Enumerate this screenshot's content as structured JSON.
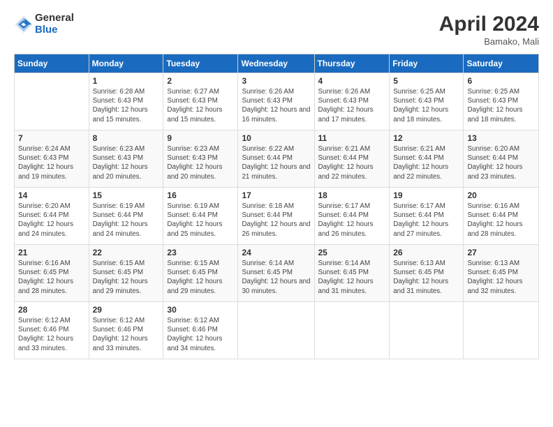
{
  "header": {
    "logo_line1": "General",
    "logo_line2": "Blue",
    "title": "April 2024",
    "subtitle": "Bamako, Mali"
  },
  "weekdays": [
    "Sunday",
    "Monday",
    "Tuesday",
    "Wednesday",
    "Thursday",
    "Friday",
    "Saturday"
  ],
  "weeks": [
    [
      {
        "day": "",
        "sunrise": "",
        "sunset": "",
        "daylight": ""
      },
      {
        "day": "1",
        "sunrise": "Sunrise: 6:28 AM",
        "sunset": "Sunset: 6:43 PM",
        "daylight": "Daylight: 12 hours and 15 minutes."
      },
      {
        "day": "2",
        "sunrise": "Sunrise: 6:27 AM",
        "sunset": "Sunset: 6:43 PM",
        "daylight": "Daylight: 12 hours and 15 minutes."
      },
      {
        "day": "3",
        "sunrise": "Sunrise: 6:26 AM",
        "sunset": "Sunset: 6:43 PM",
        "daylight": "Daylight: 12 hours and 16 minutes."
      },
      {
        "day": "4",
        "sunrise": "Sunrise: 6:26 AM",
        "sunset": "Sunset: 6:43 PM",
        "daylight": "Daylight: 12 hours and 17 minutes."
      },
      {
        "day": "5",
        "sunrise": "Sunrise: 6:25 AM",
        "sunset": "Sunset: 6:43 PM",
        "daylight": "Daylight: 12 hours and 18 minutes."
      },
      {
        "day": "6",
        "sunrise": "Sunrise: 6:25 AM",
        "sunset": "Sunset: 6:43 PM",
        "daylight": "Daylight: 12 hours and 18 minutes."
      }
    ],
    [
      {
        "day": "7",
        "sunrise": "Sunrise: 6:24 AM",
        "sunset": "Sunset: 6:43 PM",
        "daylight": "Daylight: 12 hours and 19 minutes."
      },
      {
        "day": "8",
        "sunrise": "Sunrise: 6:23 AM",
        "sunset": "Sunset: 6:43 PM",
        "daylight": "Daylight: 12 hours and 20 minutes."
      },
      {
        "day": "9",
        "sunrise": "Sunrise: 6:23 AM",
        "sunset": "Sunset: 6:43 PM",
        "daylight": "Daylight: 12 hours and 20 minutes."
      },
      {
        "day": "10",
        "sunrise": "Sunrise: 6:22 AM",
        "sunset": "Sunset: 6:44 PM",
        "daylight": "Daylight: 12 hours and 21 minutes."
      },
      {
        "day": "11",
        "sunrise": "Sunrise: 6:21 AM",
        "sunset": "Sunset: 6:44 PM",
        "daylight": "Daylight: 12 hours and 22 minutes."
      },
      {
        "day": "12",
        "sunrise": "Sunrise: 6:21 AM",
        "sunset": "Sunset: 6:44 PM",
        "daylight": "Daylight: 12 hours and 22 minutes."
      },
      {
        "day": "13",
        "sunrise": "Sunrise: 6:20 AM",
        "sunset": "Sunset: 6:44 PM",
        "daylight": "Daylight: 12 hours and 23 minutes."
      }
    ],
    [
      {
        "day": "14",
        "sunrise": "Sunrise: 6:20 AM",
        "sunset": "Sunset: 6:44 PM",
        "daylight": "Daylight: 12 hours and 24 minutes."
      },
      {
        "day": "15",
        "sunrise": "Sunrise: 6:19 AM",
        "sunset": "Sunset: 6:44 PM",
        "daylight": "Daylight: 12 hours and 24 minutes."
      },
      {
        "day": "16",
        "sunrise": "Sunrise: 6:19 AM",
        "sunset": "Sunset: 6:44 PM",
        "daylight": "Daylight: 12 hours and 25 minutes."
      },
      {
        "day": "17",
        "sunrise": "Sunrise: 6:18 AM",
        "sunset": "Sunset: 6:44 PM",
        "daylight": "Daylight: 12 hours and 26 minutes."
      },
      {
        "day": "18",
        "sunrise": "Sunrise: 6:17 AM",
        "sunset": "Sunset: 6:44 PM",
        "daylight": "Daylight: 12 hours and 26 minutes."
      },
      {
        "day": "19",
        "sunrise": "Sunrise: 6:17 AM",
        "sunset": "Sunset: 6:44 PM",
        "daylight": "Daylight: 12 hours and 27 minutes."
      },
      {
        "day": "20",
        "sunrise": "Sunrise: 6:16 AM",
        "sunset": "Sunset: 6:44 PM",
        "daylight": "Daylight: 12 hours and 28 minutes."
      }
    ],
    [
      {
        "day": "21",
        "sunrise": "Sunrise: 6:16 AM",
        "sunset": "Sunset: 6:45 PM",
        "daylight": "Daylight: 12 hours and 28 minutes."
      },
      {
        "day": "22",
        "sunrise": "Sunrise: 6:15 AM",
        "sunset": "Sunset: 6:45 PM",
        "daylight": "Daylight: 12 hours and 29 minutes."
      },
      {
        "day": "23",
        "sunrise": "Sunrise: 6:15 AM",
        "sunset": "Sunset: 6:45 PM",
        "daylight": "Daylight: 12 hours and 29 minutes."
      },
      {
        "day": "24",
        "sunrise": "Sunrise: 6:14 AM",
        "sunset": "Sunset: 6:45 PM",
        "daylight": "Daylight: 12 hours and 30 minutes."
      },
      {
        "day": "25",
        "sunrise": "Sunrise: 6:14 AM",
        "sunset": "Sunset: 6:45 PM",
        "daylight": "Daylight: 12 hours and 31 minutes."
      },
      {
        "day": "26",
        "sunrise": "Sunrise: 6:13 AM",
        "sunset": "Sunset: 6:45 PM",
        "daylight": "Daylight: 12 hours and 31 minutes."
      },
      {
        "day": "27",
        "sunrise": "Sunrise: 6:13 AM",
        "sunset": "Sunset: 6:45 PM",
        "daylight": "Daylight: 12 hours and 32 minutes."
      }
    ],
    [
      {
        "day": "28",
        "sunrise": "Sunrise: 6:12 AM",
        "sunset": "Sunset: 6:46 PM",
        "daylight": "Daylight: 12 hours and 33 minutes."
      },
      {
        "day": "29",
        "sunrise": "Sunrise: 6:12 AM",
        "sunset": "Sunset: 6:46 PM",
        "daylight": "Daylight: 12 hours and 33 minutes."
      },
      {
        "day": "30",
        "sunrise": "Sunrise: 6:12 AM",
        "sunset": "Sunset: 6:46 PM",
        "daylight": "Daylight: 12 hours and 34 minutes."
      },
      {
        "day": "",
        "sunrise": "",
        "sunset": "",
        "daylight": ""
      },
      {
        "day": "",
        "sunrise": "",
        "sunset": "",
        "daylight": ""
      },
      {
        "day": "",
        "sunrise": "",
        "sunset": "",
        "daylight": ""
      },
      {
        "day": "",
        "sunrise": "",
        "sunset": "",
        "daylight": ""
      }
    ]
  ]
}
